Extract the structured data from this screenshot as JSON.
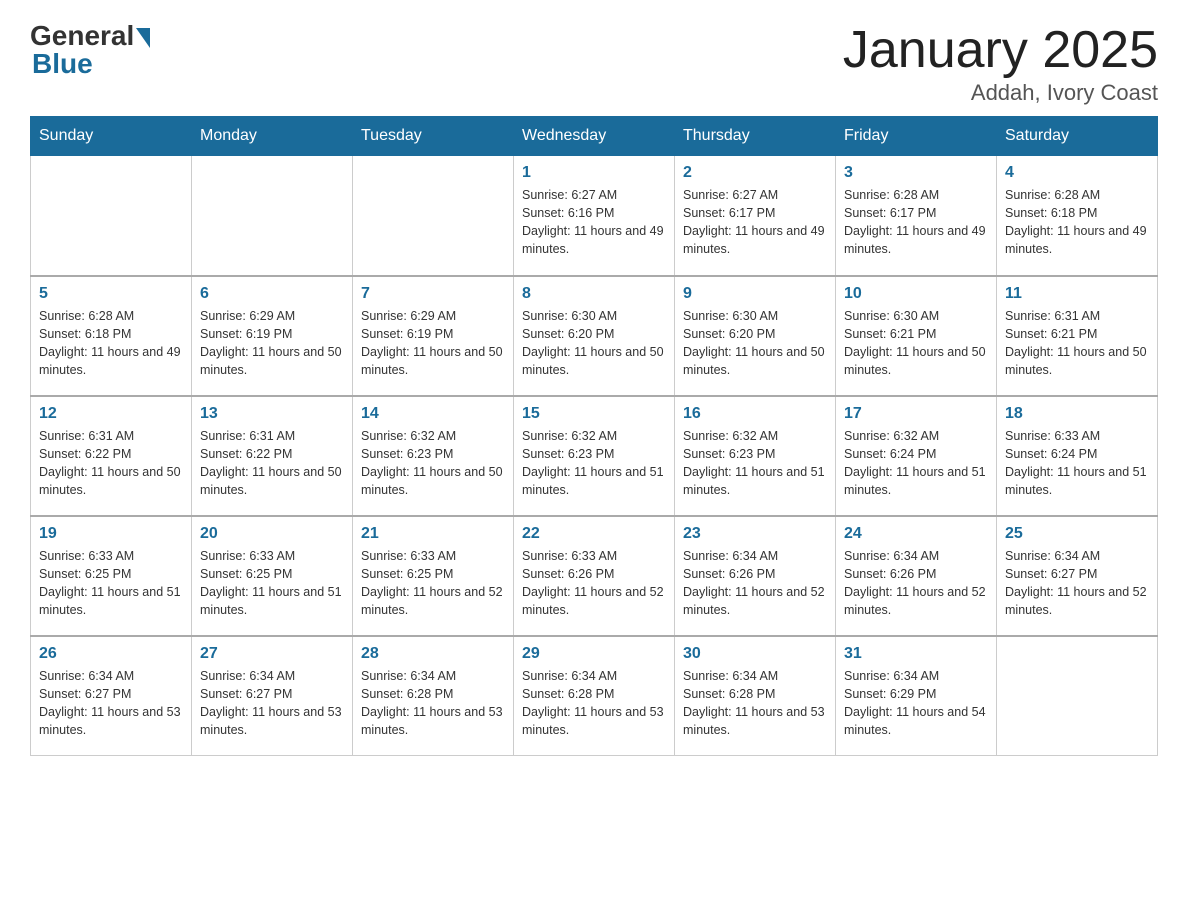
{
  "logo": {
    "general": "General",
    "blue": "Blue"
  },
  "title": "January 2025",
  "subtitle": "Addah, Ivory Coast",
  "days_of_week": [
    "Sunday",
    "Monday",
    "Tuesday",
    "Wednesday",
    "Thursday",
    "Friday",
    "Saturday"
  ],
  "weeks": [
    [
      {
        "num": "",
        "info": ""
      },
      {
        "num": "",
        "info": ""
      },
      {
        "num": "",
        "info": ""
      },
      {
        "num": "1",
        "info": "Sunrise: 6:27 AM\nSunset: 6:16 PM\nDaylight: 11 hours and 49 minutes."
      },
      {
        "num": "2",
        "info": "Sunrise: 6:27 AM\nSunset: 6:17 PM\nDaylight: 11 hours and 49 minutes."
      },
      {
        "num": "3",
        "info": "Sunrise: 6:28 AM\nSunset: 6:17 PM\nDaylight: 11 hours and 49 minutes."
      },
      {
        "num": "4",
        "info": "Sunrise: 6:28 AM\nSunset: 6:18 PM\nDaylight: 11 hours and 49 minutes."
      }
    ],
    [
      {
        "num": "5",
        "info": "Sunrise: 6:28 AM\nSunset: 6:18 PM\nDaylight: 11 hours and 49 minutes."
      },
      {
        "num": "6",
        "info": "Sunrise: 6:29 AM\nSunset: 6:19 PM\nDaylight: 11 hours and 50 minutes."
      },
      {
        "num": "7",
        "info": "Sunrise: 6:29 AM\nSunset: 6:19 PM\nDaylight: 11 hours and 50 minutes."
      },
      {
        "num": "8",
        "info": "Sunrise: 6:30 AM\nSunset: 6:20 PM\nDaylight: 11 hours and 50 minutes."
      },
      {
        "num": "9",
        "info": "Sunrise: 6:30 AM\nSunset: 6:20 PM\nDaylight: 11 hours and 50 minutes."
      },
      {
        "num": "10",
        "info": "Sunrise: 6:30 AM\nSunset: 6:21 PM\nDaylight: 11 hours and 50 minutes."
      },
      {
        "num": "11",
        "info": "Sunrise: 6:31 AM\nSunset: 6:21 PM\nDaylight: 11 hours and 50 minutes."
      }
    ],
    [
      {
        "num": "12",
        "info": "Sunrise: 6:31 AM\nSunset: 6:22 PM\nDaylight: 11 hours and 50 minutes."
      },
      {
        "num": "13",
        "info": "Sunrise: 6:31 AM\nSunset: 6:22 PM\nDaylight: 11 hours and 50 minutes."
      },
      {
        "num": "14",
        "info": "Sunrise: 6:32 AM\nSunset: 6:23 PM\nDaylight: 11 hours and 50 minutes."
      },
      {
        "num": "15",
        "info": "Sunrise: 6:32 AM\nSunset: 6:23 PM\nDaylight: 11 hours and 51 minutes."
      },
      {
        "num": "16",
        "info": "Sunrise: 6:32 AM\nSunset: 6:23 PM\nDaylight: 11 hours and 51 minutes."
      },
      {
        "num": "17",
        "info": "Sunrise: 6:32 AM\nSunset: 6:24 PM\nDaylight: 11 hours and 51 minutes."
      },
      {
        "num": "18",
        "info": "Sunrise: 6:33 AM\nSunset: 6:24 PM\nDaylight: 11 hours and 51 minutes."
      }
    ],
    [
      {
        "num": "19",
        "info": "Sunrise: 6:33 AM\nSunset: 6:25 PM\nDaylight: 11 hours and 51 minutes."
      },
      {
        "num": "20",
        "info": "Sunrise: 6:33 AM\nSunset: 6:25 PM\nDaylight: 11 hours and 51 minutes."
      },
      {
        "num": "21",
        "info": "Sunrise: 6:33 AM\nSunset: 6:25 PM\nDaylight: 11 hours and 52 minutes."
      },
      {
        "num": "22",
        "info": "Sunrise: 6:33 AM\nSunset: 6:26 PM\nDaylight: 11 hours and 52 minutes."
      },
      {
        "num": "23",
        "info": "Sunrise: 6:34 AM\nSunset: 6:26 PM\nDaylight: 11 hours and 52 minutes."
      },
      {
        "num": "24",
        "info": "Sunrise: 6:34 AM\nSunset: 6:26 PM\nDaylight: 11 hours and 52 minutes."
      },
      {
        "num": "25",
        "info": "Sunrise: 6:34 AM\nSunset: 6:27 PM\nDaylight: 11 hours and 52 minutes."
      }
    ],
    [
      {
        "num": "26",
        "info": "Sunrise: 6:34 AM\nSunset: 6:27 PM\nDaylight: 11 hours and 53 minutes."
      },
      {
        "num": "27",
        "info": "Sunrise: 6:34 AM\nSunset: 6:27 PM\nDaylight: 11 hours and 53 minutes."
      },
      {
        "num": "28",
        "info": "Sunrise: 6:34 AM\nSunset: 6:28 PM\nDaylight: 11 hours and 53 minutes."
      },
      {
        "num": "29",
        "info": "Sunrise: 6:34 AM\nSunset: 6:28 PM\nDaylight: 11 hours and 53 minutes."
      },
      {
        "num": "30",
        "info": "Sunrise: 6:34 AM\nSunset: 6:28 PM\nDaylight: 11 hours and 53 minutes."
      },
      {
        "num": "31",
        "info": "Sunrise: 6:34 AM\nSunset: 6:29 PM\nDaylight: 11 hours and 54 minutes."
      },
      {
        "num": "",
        "info": ""
      }
    ]
  ]
}
